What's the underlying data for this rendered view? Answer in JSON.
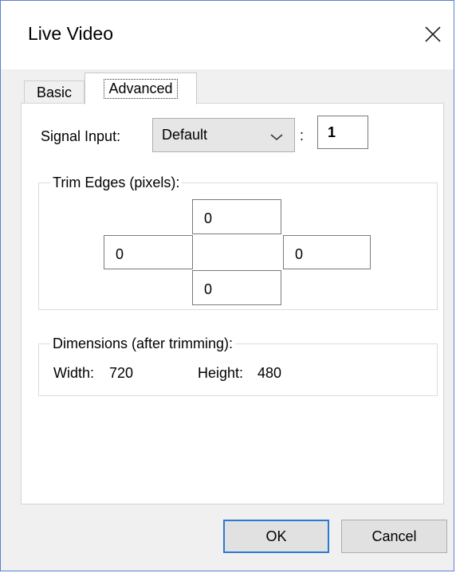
{
  "window": {
    "title": "Live Video"
  },
  "tabs": [
    {
      "label": "Basic",
      "active": false
    },
    {
      "label": "Advanced",
      "active": true
    }
  ],
  "signal": {
    "label": "Signal Input:",
    "selected": "Default",
    "separator": ":",
    "number": "1"
  },
  "trim": {
    "title": "Trim Edges (pixels):",
    "top": "0",
    "left": "0",
    "right": "0",
    "bottom": "0"
  },
  "dimensions": {
    "title": "Dimensions (after trimming):",
    "width_label": "Width:",
    "width_value": "720",
    "height_label": "Height:",
    "height_value": "480"
  },
  "buttons": {
    "ok": "OK",
    "cancel": "Cancel"
  },
  "colors": {
    "accent": "#2a7ad3",
    "window_border": "#5b7fd4",
    "dialog_bg": "#f0f0f0"
  }
}
